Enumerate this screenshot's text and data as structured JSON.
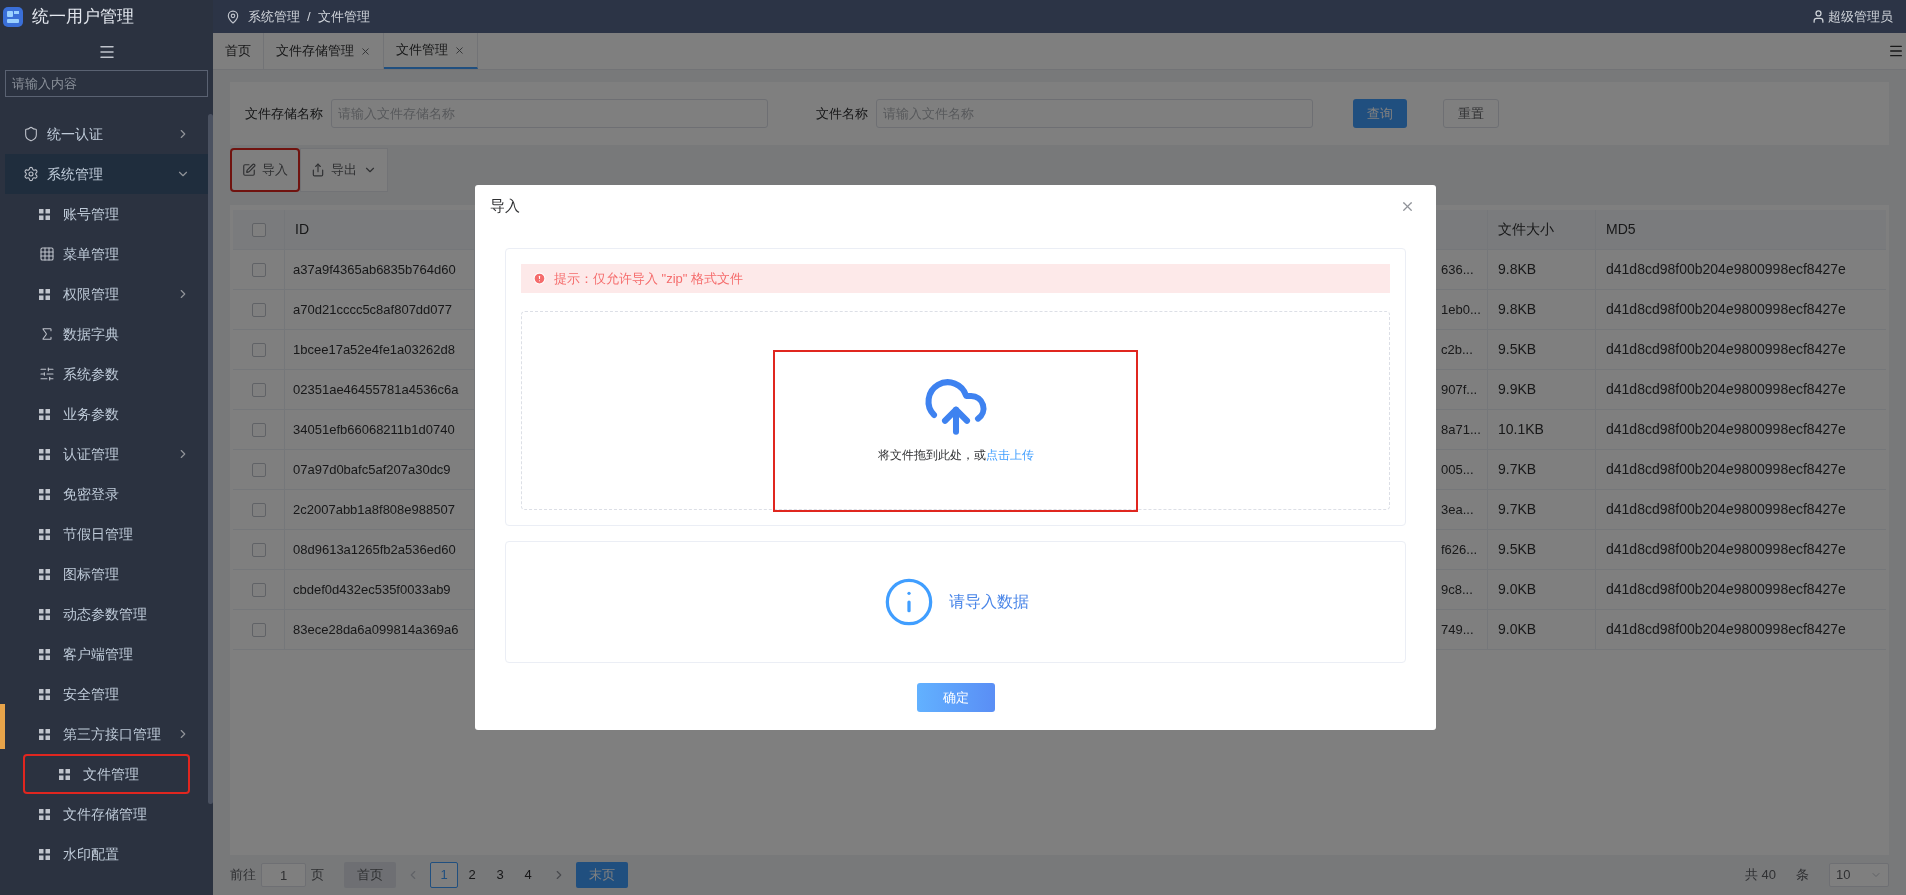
{
  "sidebar": {
    "title": "统一用户管理",
    "search": {
      "placeholder": "请输入内容"
    },
    "items": [
      {
        "label": "统一认证",
        "kind": "shield",
        "expanded": false,
        "highlighted": false
      },
      {
        "label": "系统管理",
        "kind": "gear",
        "expanded": true,
        "highlighted": false,
        "children": [
          {
            "label": "账号管理",
            "kind": "grid",
            "highlighted": false
          },
          {
            "label": "菜单管理",
            "kind": "table",
            "highlighted": false
          },
          {
            "label": "权限管理",
            "kind": "grid",
            "expanded": false,
            "highlighted": false
          },
          {
            "label": "数据字典",
            "kind": "formula",
            "highlighted": false
          },
          {
            "label": "系统参数",
            "kind": "param",
            "highlighted": false
          },
          {
            "label": "业务参数",
            "kind": "grid",
            "highlighted": false
          },
          {
            "label": "认证管理",
            "kind": "grid",
            "expanded": false,
            "highlighted": false
          },
          {
            "label": "免密登录",
            "kind": "grid",
            "highlighted": false
          },
          {
            "label": "节假日管理",
            "kind": "grid",
            "highlighted": false
          },
          {
            "label": "图标管理",
            "kind": "grid",
            "highlighted": false
          },
          {
            "label": "动态参数管理",
            "kind": "grid",
            "highlighted": false
          },
          {
            "label": "客户端管理",
            "kind": "grid",
            "highlighted": false
          },
          {
            "label": "安全管理",
            "kind": "grid",
            "highlighted": false
          },
          {
            "label": "第三方接口管理",
            "kind": "grid",
            "expanded": false,
            "highlighted": false
          },
          {
            "label": "文件管理",
            "kind": "grid",
            "highlighted": true
          },
          {
            "label": "文件存储管理",
            "kind": "grid",
            "highlighted": false
          },
          {
            "label": "水印配置",
            "kind": "grid",
            "highlighted": false
          }
        ]
      }
    ]
  },
  "topbar": {
    "breadcrumb": [
      "系统管理",
      "/",
      "文件管理"
    ],
    "user": "超级管理员"
  },
  "tabs": [
    {
      "label": "首页",
      "closable": false,
      "selected": false
    },
    {
      "label": "文件存储管理",
      "closable": true,
      "selected": false
    },
    {
      "label": "文件管理",
      "closable": true,
      "selected": true
    }
  ],
  "filters": [
    {
      "label": "文件存储名称",
      "placeholder": "请输入文件存储名称"
    },
    {
      "label": "文件名称",
      "placeholder": "请输入文件名称"
    }
  ],
  "filter_buttons": [
    {
      "label": "查询",
      "kind": "primary"
    },
    {
      "label": "重置",
      "kind": "plain"
    }
  ],
  "toolbar": [
    {
      "label": "导入",
      "kind": "import",
      "highlighted": true
    },
    {
      "label": "导出",
      "kind": "export",
      "highlighted": false
    }
  ],
  "table": {
    "header_checked": false,
    "columns": [
      "ID",
      "文件大小",
      "MD5"
    ],
    "rows": [
      {
        "checked": false,
        "id": "a37a9f4365ab6835b764d60",
        "column_3": "636...",
        "size": "9.8KB",
        "md5": "d41d8cd98f00b204e9800998ecf8427e"
      },
      {
        "checked": false,
        "id": "a70d21cccc5c8af807dd077",
        "column_3": "1eb0...",
        "size": "9.8KB",
        "md5": "d41d8cd98f00b204e9800998ecf8427e"
      },
      {
        "checked": false,
        "id": "1bcee17a52e4fe1a03262d8",
        "column_3": "c2b...",
        "size": "9.5KB",
        "md5": "d41d8cd98f00b204e9800998ecf8427e"
      },
      {
        "checked": false,
        "id": "02351ae46455781a4536c6a",
        "column_3": "907f...",
        "size": "9.9KB",
        "md5": "d41d8cd98f00b204e9800998ecf8427e"
      },
      {
        "checked": false,
        "id": "34051efb66068211b1d0740",
        "column_3": "8a71...",
        "size": "10.1KB",
        "md5": "d41d8cd98f00b204e9800998ecf8427e"
      },
      {
        "checked": false,
        "id": "07a97d0bafc5af207a30dc9",
        "column_3": "005...",
        "size": "9.7KB",
        "md5": "d41d8cd98f00b204e9800998ecf8427e"
      },
      {
        "checked": false,
        "id": "2c2007abb1a8f808e988507",
        "column_3": "3ea...",
        "size": "9.7KB",
        "md5": "d41d8cd98f00b204e9800998ecf8427e"
      },
      {
        "checked": false,
        "id": "08d9613a1265fb2a536ed60",
        "column_3": "f626...",
        "size": "9.5KB",
        "md5": "d41d8cd98f00b204e9800998ecf8427e"
      },
      {
        "checked": false,
        "id": "cbdef0d432ec535f0033ab9",
        "column_3": "9c8...",
        "size": "9.0KB",
        "md5": "d41d8cd98f00b204e9800998ecf8427e"
      },
      {
        "checked": false,
        "id": "83ece28da6a099814a369a6",
        "column_3": "749...",
        "size": "9.0KB",
        "md5": "d41d8cd98f00b204e9800998ecf8427e"
      }
    ]
  },
  "pagination": {
    "goto_label": "前往",
    "goto_value": "1",
    "goto_unit": "页",
    "first": {
      "label": "首页",
      "disabled": true
    },
    "pages": [
      {
        "label": "1",
        "selected": true
      },
      {
        "label": "2",
        "selected": false
      },
      {
        "label": "3",
        "selected": false
      },
      {
        "label": "4",
        "selected": false
      }
    ],
    "last": {
      "label": "末页",
      "disabled": false
    },
    "total": "共 40",
    "unit": "条",
    "page_size": "10"
  },
  "modal": {
    "title": "导入",
    "notice": "提示：仅允许导入 \"zip\" 格式文件",
    "drop_text": "将文件拖到此处，或",
    "drop_link": "点击上传",
    "upload_highlighted": true,
    "empty_text": "请导入数据",
    "confirm": "确定"
  }
}
